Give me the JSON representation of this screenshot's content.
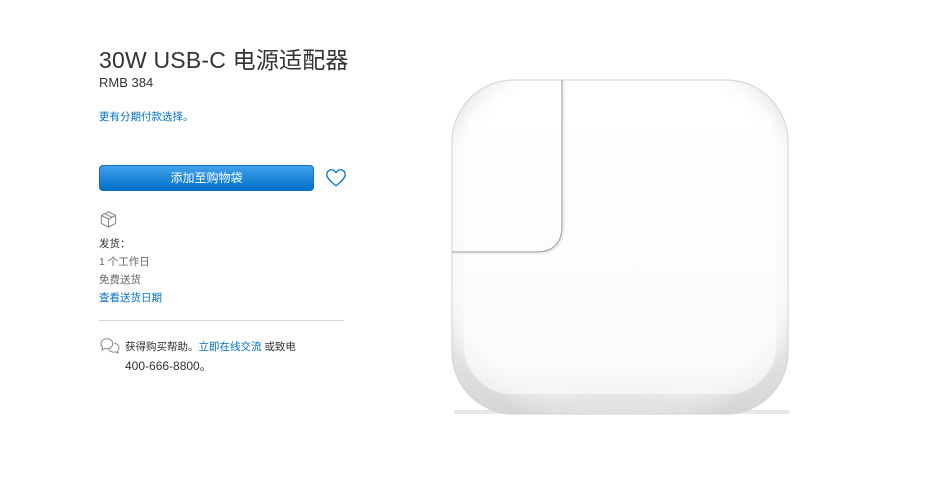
{
  "product": {
    "title": "30W USB-C 电源适配器",
    "price": "RMB 384",
    "installment_link": "更有分期付款选择。"
  },
  "actions": {
    "add_to_bag": "添加至购物袋",
    "favorite_icon": "heart-icon"
  },
  "shipping": {
    "icon": "box-icon",
    "label": "发货：",
    "days": "1 个工作日",
    "free": "免费送货",
    "dates_link": "查看送货日期"
  },
  "help": {
    "icon": "chat-bubbles-icon",
    "prefix": "获得购买帮助。",
    "chat_link": "立即在线交流",
    "suffix": " 或致电",
    "phone": "400-666-8800。"
  },
  "colors": {
    "link": "#0070c9",
    "button": "#0070c9",
    "text": "#333333"
  }
}
